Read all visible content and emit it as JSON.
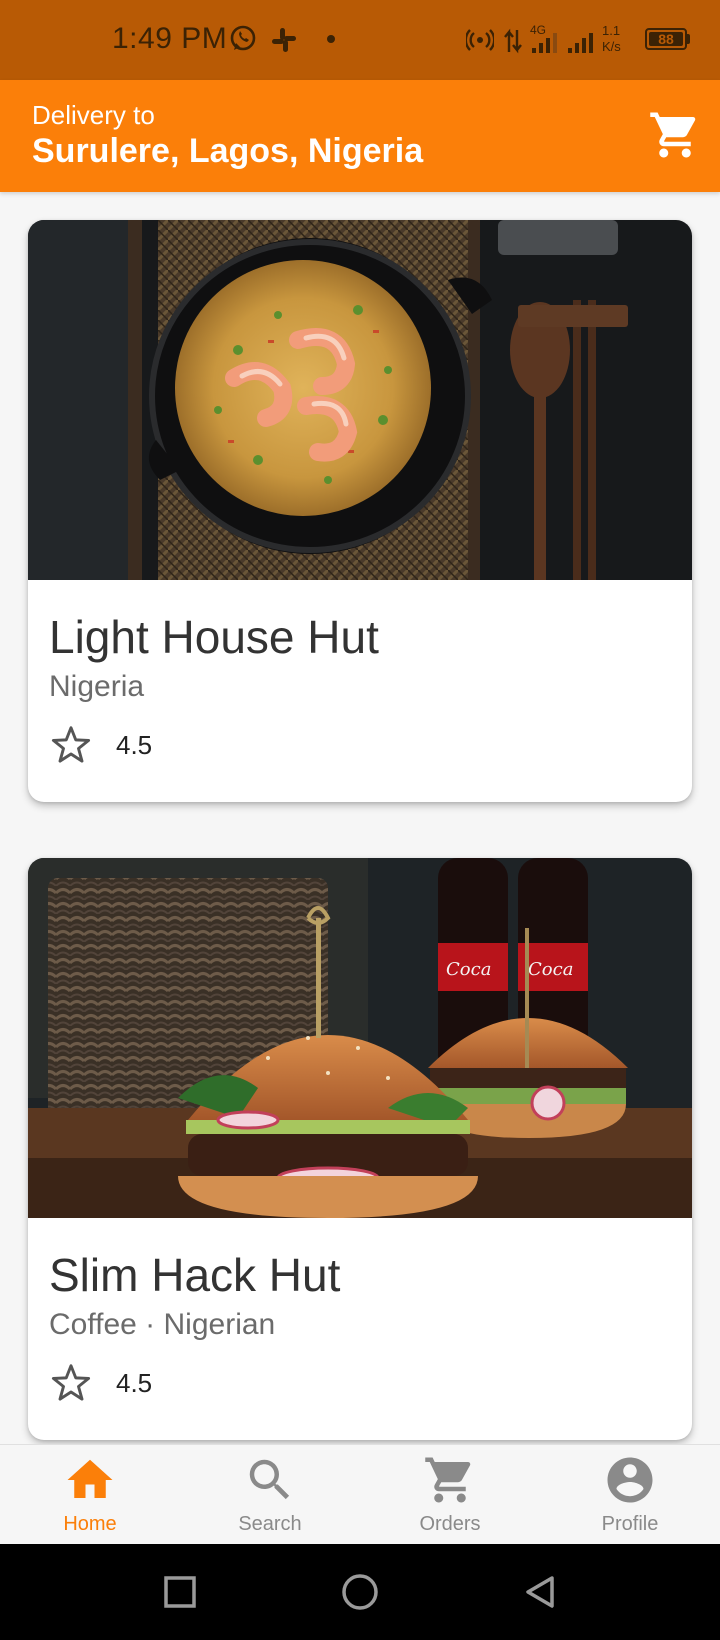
{
  "status_bar": {
    "time": "1:49 PM",
    "network_label": "4G",
    "speed_value": "1.1",
    "speed_unit": "K/s",
    "battery": "88",
    "icons": [
      "whatsapp-icon",
      "slack-icon",
      "hotspot-icon",
      "data-arrows-icon",
      "signal-icon",
      "signal-icon",
      "battery-icon"
    ]
  },
  "header": {
    "delivery_label": "Delivery to",
    "location": "Surulere, Lagos, Nigeria",
    "cart_icon": "cart-icon",
    "accent_color": "#fb7f09"
  },
  "restaurants": [
    {
      "name": "Light House Hut",
      "subtitle": "Nigeria",
      "rating": "4.5",
      "image": "jollof-rice-shrimp-photo"
    },
    {
      "name": "Slim Hack Hut",
      "subtitle": "Coffee · Nigerian",
      "rating": "4.5",
      "image": "burgers-photo"
    }
  ],
  "bottom_nav": {
    "items": [
      {
        "label": "Home",
        "icon": "home-icon",
        "active": true
      },
      {
        "label": "Search",
        "icon": "search-icon",
        "active": false
      },
      {
        "label": "Orders",
        "icon": "cart-icon",
        "active": false
      },
      {
        "label": "Profile",
        "icon": "profile-icon",
        "active": false
      }
    ]
  },
  "system_nav": [
    "recents-button",
    "home-button",
    "back-button"
  ]
}
